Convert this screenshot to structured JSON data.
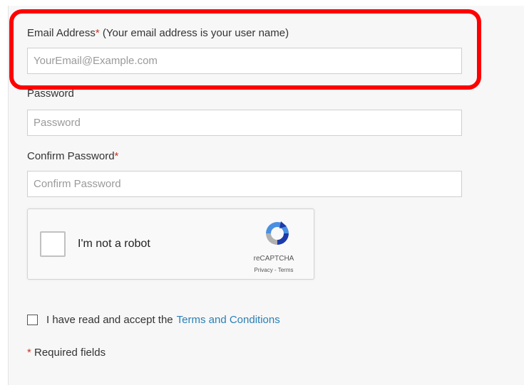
{
  "form": {
    "email": {
      "label": "Email Address",
      "required_mark": "*",
      "hint": " (Your email address is your user name)",
      "placeholder": "YourEmail@Example.com"
    },
    "password": {
      "label": "Password",
      "placeholder": "Password"
    },
    "confirm_password": {
      "label": "Confirm Password",
      "required_mark": "*",
      "placeholder": "Confirm Password"
    },
    "recaptcha": {
      "label": "I'm not a robot",
      "brand": "reCAPTCHA",
      "links": "Privacy - Terms"
    },
    "terms": {
      "text": "I have read and accept the",
      "link": "Terms and Conditions"
    },
    "required_note": {
      "mark": "*",
      "text": " Required fields"
    }
  },
  "colors": {
    "highlight": "#ff0000",
    "link": "#2a7fb5",
    "required": "#c0392b"
  }
}
